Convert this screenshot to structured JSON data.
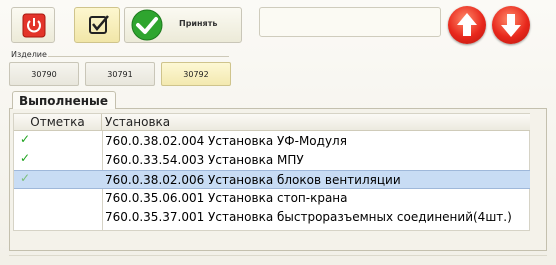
{
  "toolbar": {
    "accept_label": "Принять",
    "status_text": ""
  },
  "item_group": {
    "label": "Изделие",
    "items": [
      "30790",
      "30791",
      "30792"
    ],
    "selected": "30792"
  },
  "tab": {
    "label": "Выполненые"
  },
  "table": {
    "columns": [
      "Отметка",
      "Установка"
    ],
    "rows": [
      {
        "checked": true,
        "name": "760.0.38.02.004 Установка УФ-Модуля",
        "selected": false
      },
      {
        "checked": true,
        "name": "760.0.33.54.003 Установка МПУ",
        "selected": false
      },
      {
        "checked": true,
        "name": "760.0.38.02.006 Установка блоков вентиляции",
        "selected": true
      },
      {
        "checked": false,
        "name": "760.0.35.06.001  Установка стоп-крана",
        "selected": false
      },
      {
        "checked": false,
        "name": "760.0.35.37.001 Установка быстроразъемных соединений(4шт.)",
        "selected": false
      }
    ]
  },
  "icons": {
    "power": "power-icon",
    "checkbox": "checkbox-icon",
    "accept": "check-circle-icon",
    "up": "arrow-up-icon",
    "down": "arrow-down-icon",
    "check_mark": "✓"
  },
  "colors": {
    "accent_red": "#e8281c",
    "check_green": "#1fa31f",
    "selection": "#c8dcf4"
  }
}
